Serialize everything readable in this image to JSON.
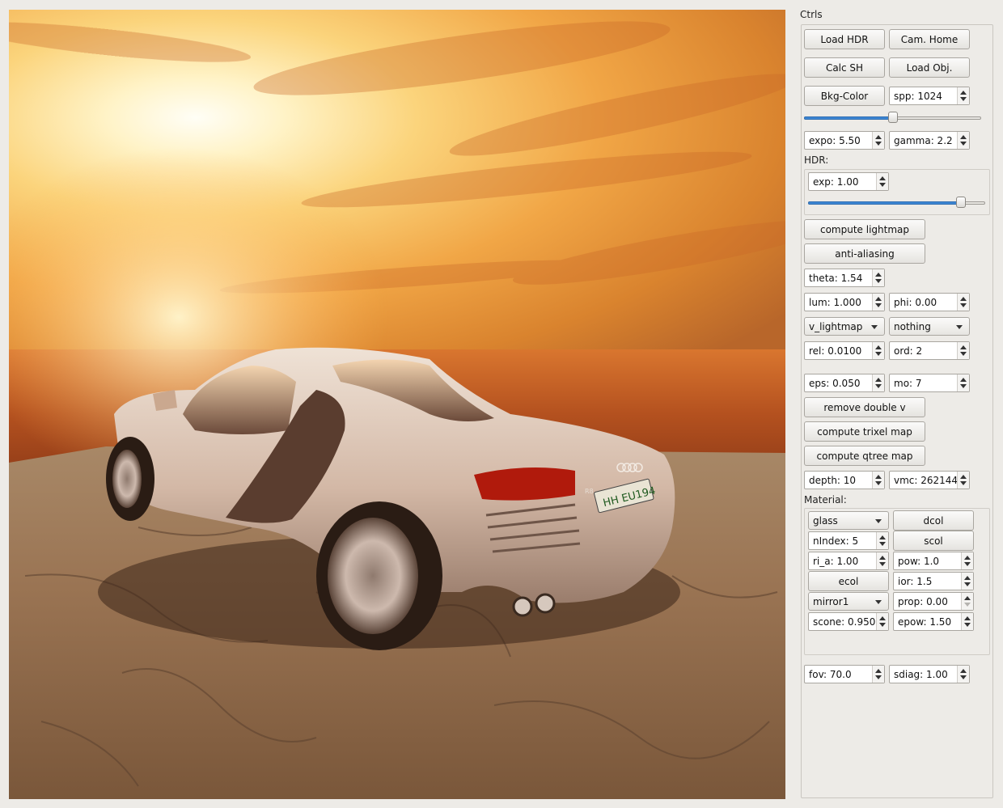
{
  "panel": {
    "title": "Ctrls",
    "load_hdr": "Load HDR",
    "cam_home": "Cam. Home",
    "calc_sh": "Calc SH",
    "load_obj": "Load Obj.",
    "bkg_color": "Bkg-Color",
    "spp": "spp: 1024",
    "spp_slider_level": 0.5,
    "expo": "expo: 5.50",
    "gamma": "gamma: 2.2",
    "hdr_label": "HDR:",
    "hdr_exp": "exp: 1.00",
    "hdr_slider_level": 0.86,
    "compute_lightmap": "compute lightmap",
    "anti_aliasing": "anti-aliasing",
    "theta": "theta: 1.54",
    "lum": "lum: 1.000",
    "phi": "phi: 0.00",
    "mode_select": "v_lightmap",
    "nothing_select": "nothing",
    "rel": "rel: 0.0100",
    "ord": "ord: 2",
    "eps": "eps: 0.050",
    "mo": "mo: 7",
    "remove_double_v": "remove double v",
    "compute_trixel_map": "compute trixel map",
    "compute_qtree_map": "compute qtree map",
    "depth": "depth: 10",
    "vmc": "vmc: 262144",
    "material_label": "Material:",
    "material": {
      "type_select": "glass",
      "dcol": "dcol",
      "nindex": "nIndex: 5",
      "scol": "scol",
      "ri_a": "ri_a: 1.00",
      "pow": "pow: 1.0",
      "ecol": "ecol",
      "ior": "ior: 1.5",
      "mirror_select": "mirror1",
      "prop": "prop: 0.00",
      "scone": "scone: 0.950",
      "epow": "epow: 1.50"
    },
    "fov": "fov: 70.0",
    "sdiag": "sdiag: 1.00"
  },
  "viewport": {
    "plate_text": "HH EU194",
    "badge_text": "R8"
  },
  "colors": {
    "accent": "#3d86d4",
    "window_bg": "#edebe7"
  }
}
